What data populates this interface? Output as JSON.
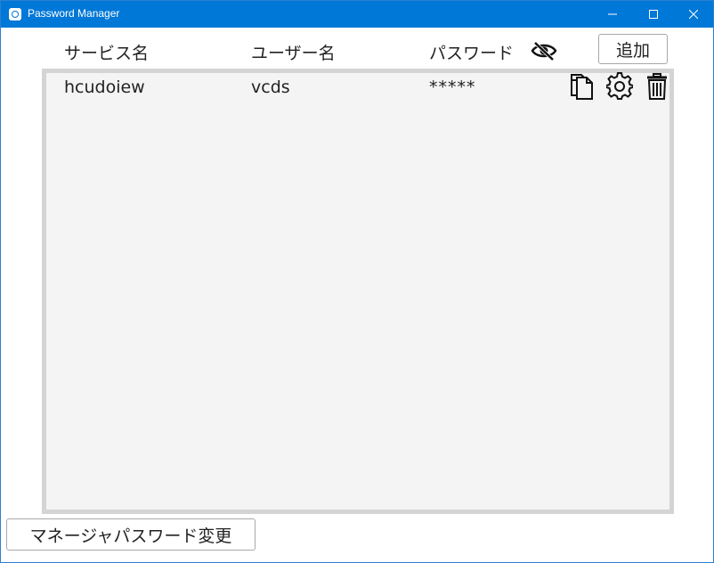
{
  "window": {
    "title": "Password Manager",
    "titlebar_color": "#0078d7"
  },
  "header": {
    "service_label": "サービス名",
    "user_label": "ユーザー名",
    "password_label": "パスワード",
    "visibility_icon": "eye-slash-icon",
    "add_label": "追加"
  },
  "entries": [
    {
      "service": "hcudoiew",
      "user": "vcds",
      "password": "*****",
      "actions": [
        "copy-icon",
        "settings-icon",
        "trash-icon"
      ]
    }
  ],
  "footer": {
    "change_password_label": "マネージャパスワード変更"
  }
}
